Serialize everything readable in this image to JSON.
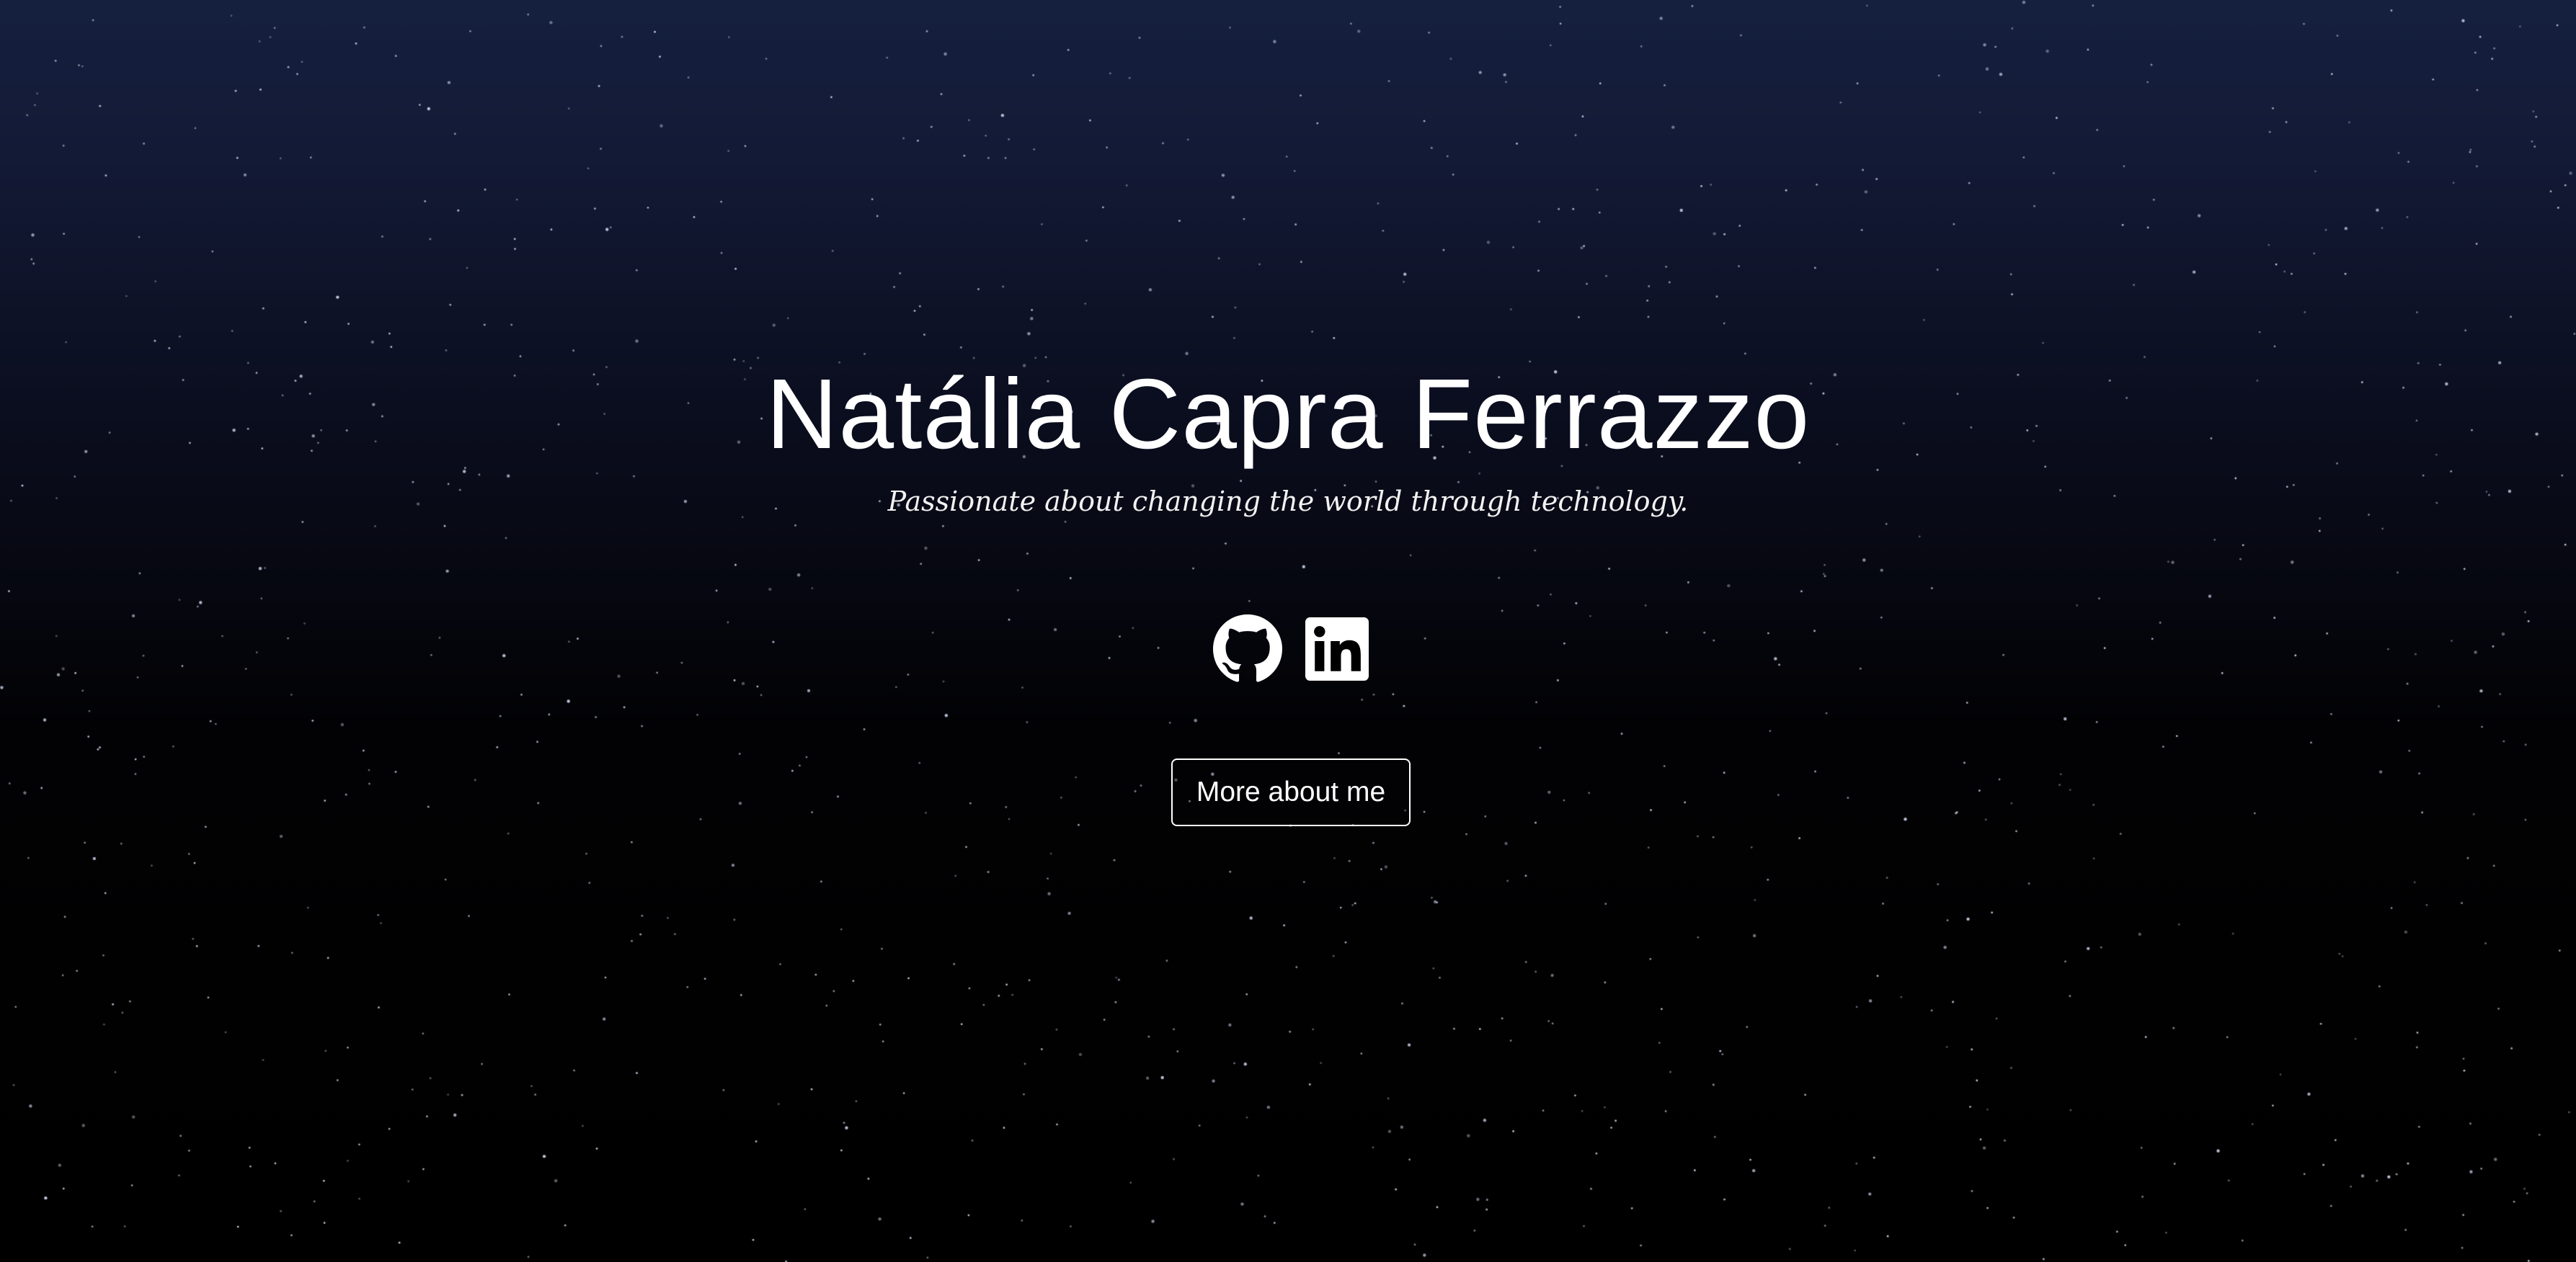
{
  "hero": {
    "name": "Natália Capra Ferrazzo",
    "tagline": "Passionate about changing the world through technology.",
    "cta_label": "More about me"
  },
  "socials": [
    {
      "icon": "github-icon",
      "label": "GitHub"
    },
    {
      "icon": "linkedin-icon",
      "label": "LinkedIn"
    }
  ],
  "colors": {
    "text": "#ffffff",
    "sky_top": "#15203f",
    "sky_bottom": "#000000",
    "star": "#c8d0e6"
  }
}
